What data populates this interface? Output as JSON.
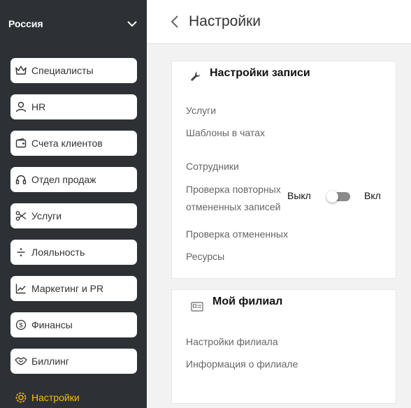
{
  "sidebar": {
    "region": "Россия",
    "items": [
      {
        "label": "Специалисты",
        "icon": "crown-icon"
      },
      {
        "label": "HR",
        "icon": "person-icon"
      },
      {
        "label": "Счета клиентов",
        "icon": "wallet-icon"
      },
      {
        "label": "Отдел продаж",
        "icon": "headset-icon"
      },
      {
        "label": "Услуги",
        "icon": "scissors-icon"
      },
      {
        "label": "Лояльность",
        "icon": "divide-icon"
      },
      {
        "label": "Маркетинг и PR",
        "icon": "chart-icon"
      },
      {
        "label": "Финансы",
        "icon": "dollar-icon"
      },
      {
        "label": "Биллинг",
        "icon": "handshake-icon"
      },
      {
        "label": "Настройки",
        "icon": "gear-icon",
        "active": true
      }
    ],
    "active_color": "#f5c000"
  },
  "header": {
    "title": "Настройки"
  },
  "booking": {
    "title": "Настройки записи",
    "links": {
      "services": "Услуги",
      "chat_templates": "Шаблоны в чатах",
      "employees": "Сотрудники",
      "check_cancelled": "Проверка отмененных",
      "resources": "Ресурсы"
    },
    "repeat_check": {
      "label": "Проверка повторных отмененных записей",
      "off_label": "Выкл",
      "on_label": "Вкл",
      "enabled": false
    }
  },
  "branch": {
    "title": "Мой филиал",
    "links": {
      "settings": "Настройки филиала",
      "info": "Информация о филиале"
    }
  }
}
